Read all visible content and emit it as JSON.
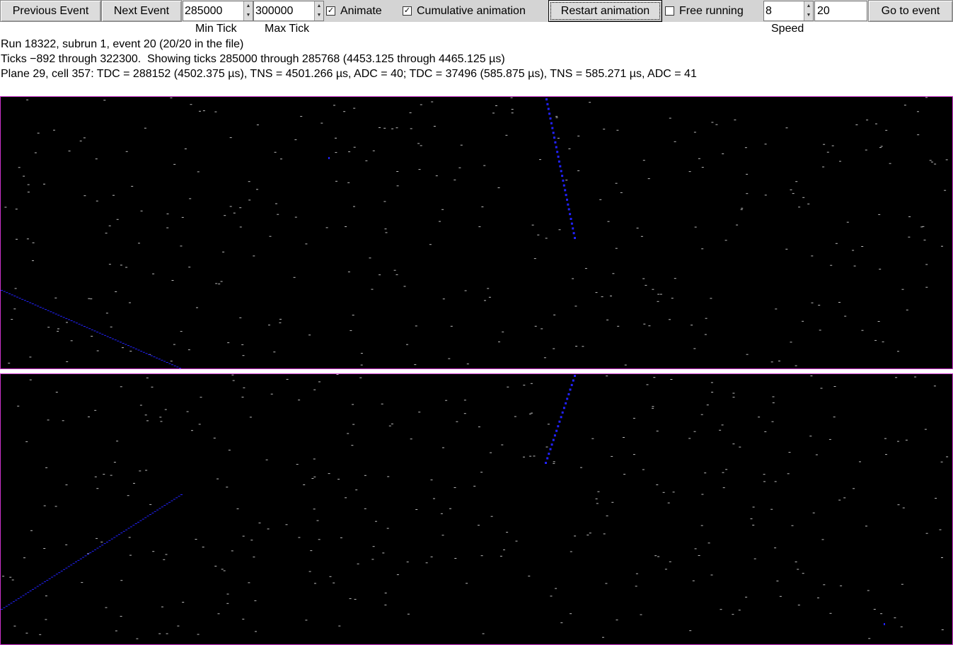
{
  "toolbar": {
    "prev_event_label": "Previous Event",
    "next_event_label": "Next Event",
    "min_tick_value": "285000",
    "max_tick_value": "300000",
    "animate_label": "Animate",
    "animate_checked": true,
    "cumulative_label": "Cumulative animation",
    "cumulative_checked": true,
    "restart_label": "Restart animation",
    "free_running_label": "Free running",
    "free_running_checked": false,
    "speed_value": "8",
    "go_to_value": "20",
    "go_to_label": "Go to event",
    "min_tick_label": "Min Tick",
    "max_tick_label": "Max Tick",
    "speed_label": "Speed"
  },
  "info": {
    "line1": "Run 18322, subrun 1, event 20 (20/20 in the file)",
    "line2": "Ticks −892 through 322300.  Showing ticks 285000 through 285768 (4453.125 through 4465.125 µs)",
    "line3": "Plane 29, cell 357: TDC = 288152 (4502.375 µs), TNS = 4501.266 µs, ADC = 40; TDC = 37496 (585.875 µs), TNS = 585.271 µs, ADC = 41"
  },
  "colors": {
    "panel_background": "#000000",
    "panel_border": "#cc33cc",
    "track_color": "#2222ff",
    "noise_color": "#bbbbbb"
  }
}
